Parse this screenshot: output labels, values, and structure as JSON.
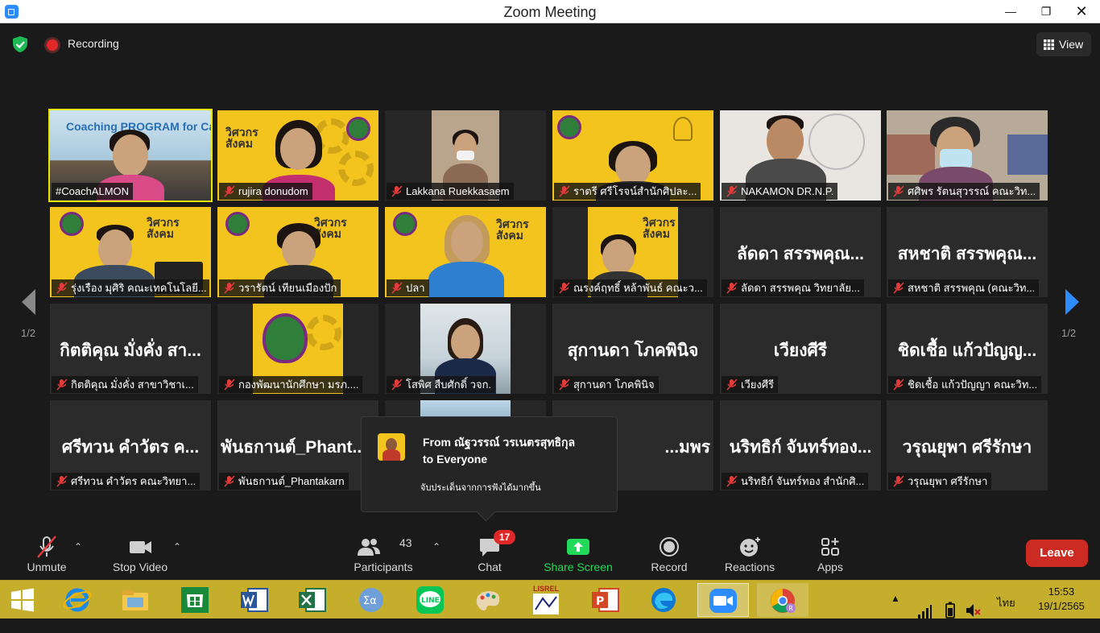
{
  "window": {
    "title": "Zoom Meeting"
  },
  "meeting_bar": {
    "recording_label": "Recording",
    "view_label": "View"
  },
  "pagination": {
    "left": "1/2",
    "right": "1/2"
  },
  "tiles": [
    {
      "name": "#CoachALMON",
      "banner": "Coaching PROGRAM for Career"
    },
    {
      "name": "rujira donudom"
    },
    {
      "name": "Lakkana Ruekkasaem"
    },
    {
      "name": "ราตรี   ศรีโรจน์สำนักศิปละ..."
    },
    {
      "name": "NAKAMON DR.N.P."
    },
    {
      "name": "ศศิพร รัตนสุวรรณ์ คณะวิท..."
    },
    {
      "name": "รุ่งเรือง มุศิริ คณะเทคโนโลยี..."
    },
    {
      "name": "วรารัตน์ เทียนเมืองปัก"
    },
    {
      "name": "ปลา"
    },
    {
      "name": "ณรงค์ฤทธิ์ หล้าพันธ์ คณะว..."
    },
    {
      "big": "ลัดดา สรรพคุณ...",
      "name": "ลัดดา สรรพคุณ  วิทยาลัย..."
    },
    {
      "big": "สหชาติ สรรพคุณ...",
      "name": "สหชาติ สรรพคุณ (คณะวิท..."
    },
    {
      "big": "กิตติคุณ  มั่งคั่ง สา...",
      "name": "กิตติคุณ  มั่งคั่ง สาขาวิชาเ..."
    },
    {
      "name": "กองพัฒนานักศึกษา มรภ...."
    },
    {
      "name": "โสพิศ สืบศักดิ์ วจก."
    },
    {
      "big": "สุกานดา โภคพินิจ",
      "name": "สุกานดา โภคพินิจ"
    },
    {
      "big": "เวียงศีรี",
      "name": "เวียงศีรี"
    },
    {
      "big": "ชิดเชื้อ แก้วปัญญ...",
      "name": "ชิดเชื้อ แก้วปัญญา คณะวิท..."
    },
    {
      "big": "ศรีทวน  คำวัตร ค...",
      "name": "ศรีทวน  คำวัตร คณะวิทยา..."
    },
    {
      "big": "พันธกานต์_Phant...",
      "name": "พันธกานต์_Phantakarn"
    },
    {
      "big": "...มพร",
      "name": ""
    },
    {
      "big": "นริทธิก์ จันทร์ทอง...",
      "name": "นริทธิก์ จันทร์ทอง สำนักศิ..."
    },
    {
      "big": "วรุณยุพา ศรีรักษา",
      "name": "วรุณยุพา ศรีรักษา"
    }
  ],
  "slide_text": {
    "line1": "วิศวกร",
    "line2": "สังคม"
  },
  "chat_popup": {
    "from": "From ณัฐวรรณ์ วรเนตรสุทธิกุล",
    "to": "to Everyone",
    "message": "จับประเด็นจากการฟังได้มากขึ้น"
  },
  "toolbar": {
    "unmute": "Unmute",
    "stop_video": "Stop Video",
    "participants": "Participants",
    "participants_count": "43",
    "chat": "Chat",
    "chat_badge": "17",
    "share_screen": "Share Screen",
    "record": "Record",
    "reactions": "Reactions",
    "apps": "Apps",
    "leave": "Leave"
  },
  "taskbar": {
    "time": "15:53",
    "date": "19/1/2565",
    "lang": "ไทย",
    "lisrel": "LISREL"
  },
  "colors": {
    "accent": "#2d8cff",
    "share_green": "#23d959",
    "leave_red": "#cc2b24",
    "active_speaker": "#e7e600",
    "taskbar": "#c5ae2c",
    "slide_yellow": "#f4c41e"
  }
}
